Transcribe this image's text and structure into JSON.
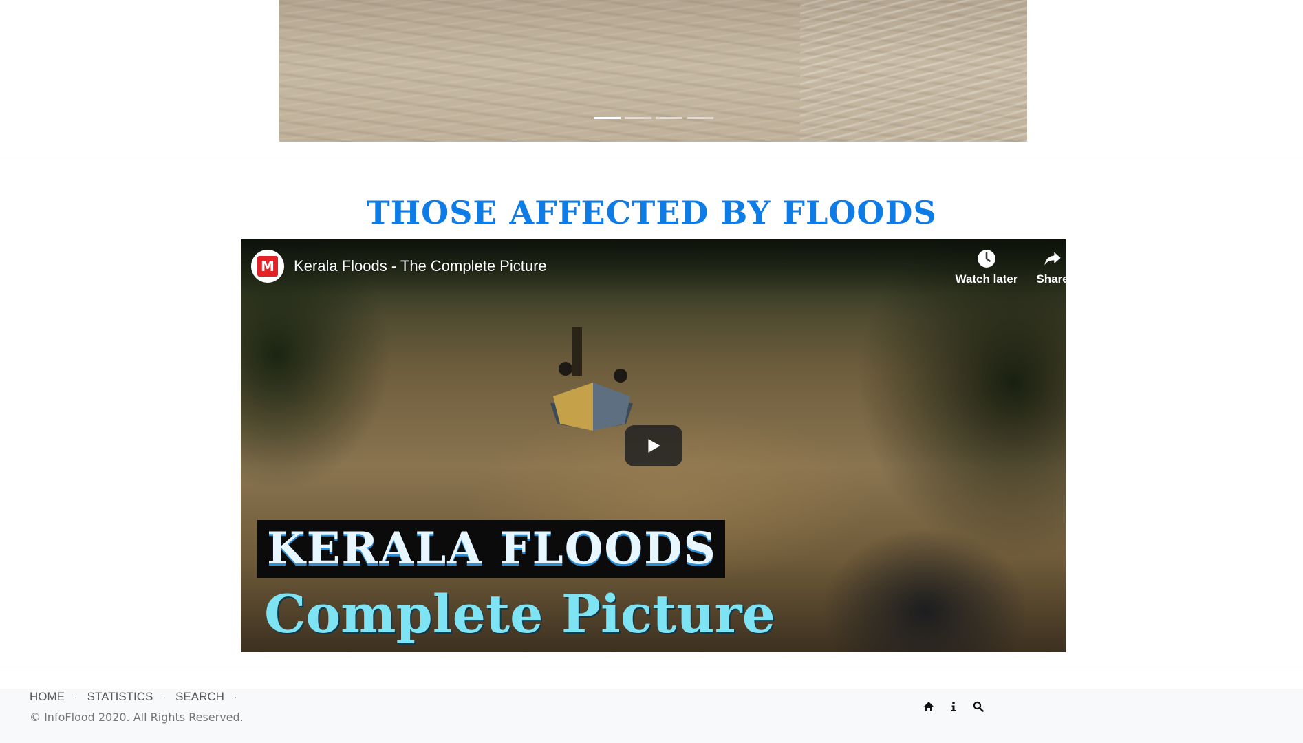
{
  "carousel": {
    "slide_count": 4,
    "active_index": 0
  },
  "section": {
    "title": "THOSE AFFECTED BY FLOODS"
  },
  "video": {
    "channel_avatar_letter": "M",
    "title": "Kerala Floods - The Complete Picture",
    "watch_later_label": "Watch later",
    "share_label": "Share",
    "thumbnail_line1": "KERALA FLOODS",
    "thumbnail_line2": "Complete Picture",
    "avatar_color": "#e32227"
  },
  "footer": {
    "nav": [
      "HOME",
      "STATISTICS",
      "SEARCH"
    ],
    "copyright": "© InfoFlood 2020. All Rights Reserved.",
    "icons": [
      "home-icon",
      "info-icon",
      "search-icon"
    ]
  },
  "colors": {
    "heading": "#0d7ce6",
    "footer_bg": "#f8f9fa"
  }
}
